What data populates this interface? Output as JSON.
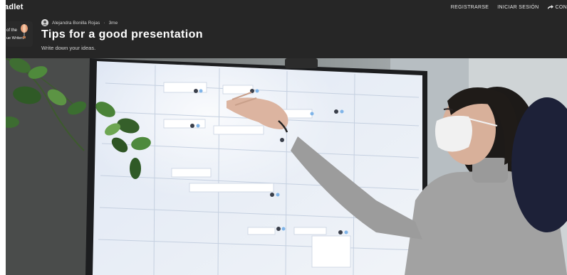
{
  "app": {
    "brand": "adlet"
  },
  "nav": {
    "register": "REGISTRARSE",
    "login": "INICIAR SESIÓN",
    "share": "CON"
  },
  "post": {
    "author": "Alejandra Bonilla Rojas",
    "separator": "·",
    "time": "3me",
    "title": "Tips for a good presentation",
    "subtitle": "Write down your ideas."
  },
  "colors": {
    "topbar_bg": "#262626",
    "text_primary": "#ffffff",
    "text_secondary": "#cfcfcf",
    "screen_bg": "#e8eef8"
  },
  "icons": {
    "share": "share-arrow-icon",
    "avatar": "user-avatar-icon",
    "logo": "balloon-logo-icon"
  }
}
